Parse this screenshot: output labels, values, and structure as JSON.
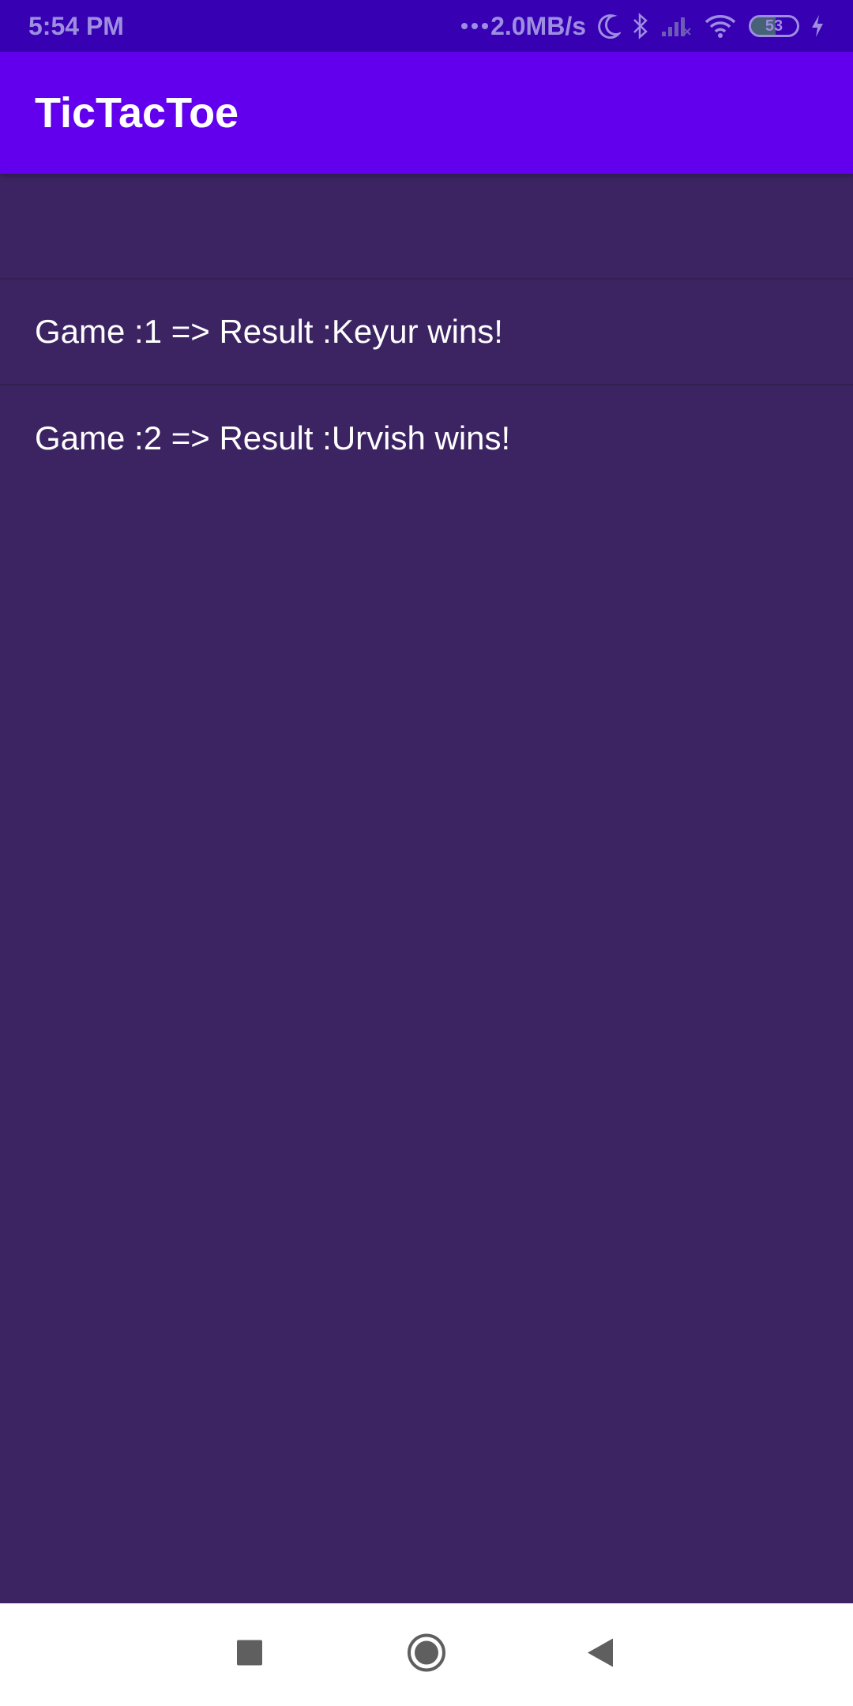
{
  "status_bar": {
    "time": "5:54 PM",
    "network_speed": "2.0MB/s",
    "battery_level": 53,
    "icons": [
      "dots-icon",
      "moon-icon",
      "bluetooth-icon",
      "signal-icon",
      "wifi-icon",
      "battery-icon",
      "charging-icon"
    ]
  },
  "app_bar": {
    "title": "TicTacToe"
  },
  "results": {
    "items": [
      {
        "label": ""
      },
      {
        "label": "Game :1 => Result :Keyur wins!"
      },
      {
        "label": "Game :2 => Result :Urvish wins!"
      }
    ]
  },
  "nav_bar": {
    "buttons": [
      "recents-button",
      "home-button",
      "back-button"
    ]
  },
  "colors": {
    "status_bar": "#3700b3",
    "app_bar": "#6200ee",
    "background": "#3c2463",
    "nav_bar": "#ffffff"
  }
}
